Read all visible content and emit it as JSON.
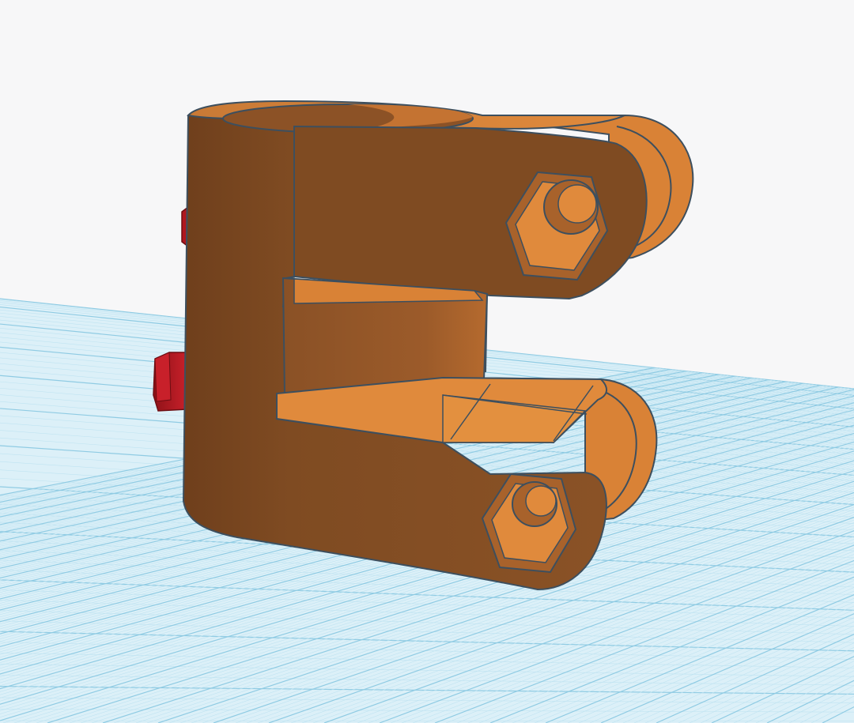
{
  "workplane": {
    "background_color": "#f7f7f8",
    "grid_color": "#9fd3ea",
    "grid_fill": "#dcf0f8",
    "minor_line_color": "#bfe3f1",
    "major_line_color": "#8fcbe3"
  },
  "model": {
    "object_type": "tube-clamp",
    "shape_color": "#e08a3c",
    "shape_dark": "#7f4b22",
    "shape_mid": "#a8622b",
    "outline_color": "#3d4f5e",
    "hardware_color": "#c8202a",
    "hardware_dark": "#8e1218",
    "icons": [
      "hex-nut-icon",
      "bolt-head-icon"
    ]
  }
}
